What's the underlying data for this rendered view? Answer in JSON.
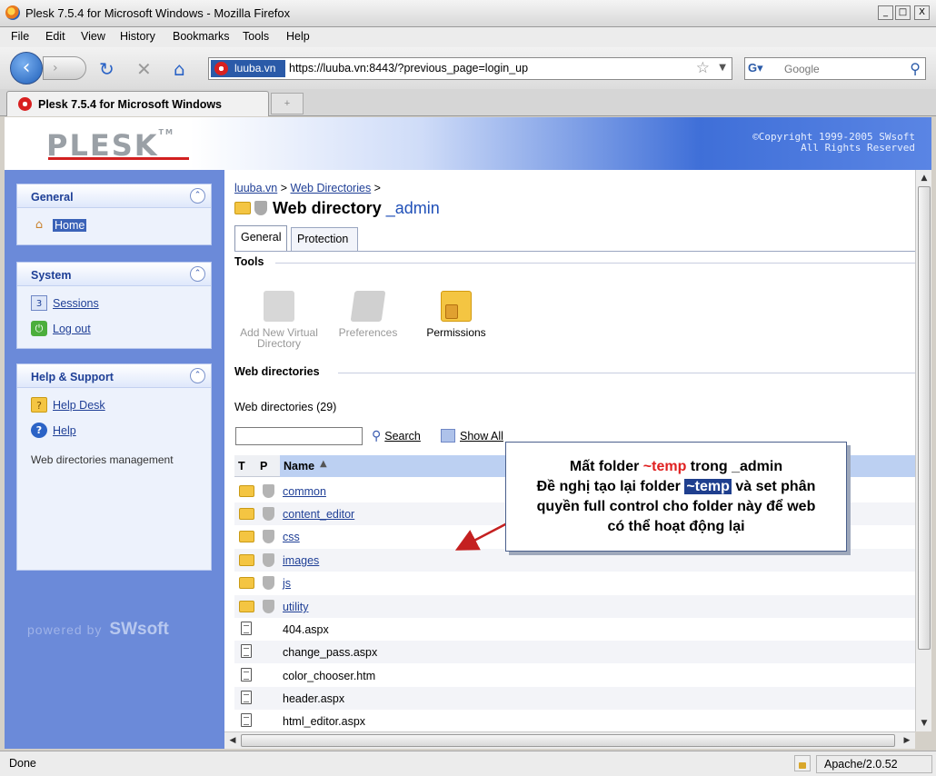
{
  "window": {
    "title": "Plesk 7.5.4 for Microsoft Windows - Mozilla Firefox",
    "min": "_",
    "max": "□",
    "close": "X"
  },
  "menu": [
    "File",
    "Edit",
    "View",
    "History",
    "Bookmarks",
    "Tools",
    "Help"
  ],
  "nav": {
    "back": "‹",
    "forward": "›",
    "reload": "↻",
    "stop": "✕",
    "home": "⌂",
    "site_badge": "luuba.vn",
    "url": "https://luuba.vn:8443/?previous_page=login_up",
    "search_placeholder": "Google"
  },
  "browser_tab": {
    "title": "Plesk 7.5.4 for Microsoft Windows",
    "new_tab": "+"
  },
  "plesk": {
    "logo": "PLESK",
    "tm": "TM",
    "copyright_line1": "©Copyright 1999-2005 SWsoft",
    "copyright_line2": "All Rights Reserved"
  },
  "sidebar": {
    "general": {
      "title": "General",
      "items": [
        {
          "label": "Home"
        }
      ]
    },
    "system": {
      "title": "System",
      "items": [
        {
          "label": "Sessions"
        },
        {
          "label": "Log out"
        }
      ]
    },
    "help": {
      "title": "Help & Support",
      "items": [
        {
          "label": "Help Desk"
        },
        {
          "label": "Help"
        }
      ],
      "note": "Web directories management"
    },
    "collapse": "⌃",
    "powered": "powered by",
    "brand": "SWsoft"
  },
  "content": {
    "breadcrumb": {
      "root": "luuba.vn",
      "sep1": " > ",
      "section": "Web Directories",
      "sep2": " >"
    },
    "title": "Web directory ",
    "title_accent": "_admin",
    "tabs": [
      "General",
      "Protection"
    ],
    "tools_heading": "Tools",
    "tools": [
      {
        "label": "Add New Virtual Directory",
        "enabled": false
      },
      {
        "label": "Preferences",
        "enabled": false
      },
      {
        "label": "Permissions",
        "enabled": true
      }
    ],
    "webdirs_heading": "Web directories",
    "count": "Web directories (29)",
    "filter_value": "",
    "search_label": "Search",
    "showall_label": "Show All",
    "columns": {
      "t": "T",
      "p": "P",
      "name": "Name",
      "sort": "▲"
    },
    "rows": [
      {
        "name": "common",
        "kind": "folder"
      },
      {
        "name": "content_editor",
        "kind": "folder"
      },
      {
        "name": "css",
        "kind": "folder"
      },
      {
        "name": "images",
        "kind": "folder"
      },
      {
        "name": "js",
        "kind": "folder"
      },
      {
        "name": "utility",
        "kind": "folder"
      },
      {
        "name": "404.aspx",
        "kind": "file"
      },
      {
        "name": "change_pass.aspx",
        "kind": "file"
      },
      {
        "name": "color_chooser.htm",
        "kind": "file"
      },
      {
        "name": "header.aspx",
        "kind": "file"
      },
      {
        "name": "html_editor.aspx",
        "kind": "file"
      }
    ]
  },
  "callout": {
    "l1a": "Mất folder ",
    "l1b": "~temp",
    "l1c": " trong _admin",
    "l2a": "Đề nghị tạo lại folder ",
    "l2b": "~temp",
    "l2c": " và set phân",
    "l3": "quyền full control cho folder này để web",
    "l4": "có thể hoạt động lại"
  },
  "status": {
    "text": "Done",
    "server": "Apache/2.0.52"
  },
  "colors": {
    "accent": "#2050b8",
    "sidebar": "#6b8ad9",
    "callout_red": "#e02020"
  }
}
